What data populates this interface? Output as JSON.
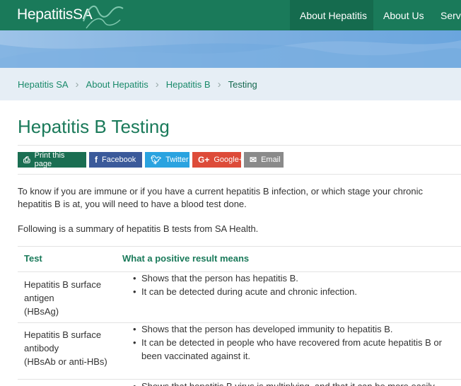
{
  "header": {
    "logo": "HepatitisSA",
    "nav": [
      "About Hepatitis",
      "About Us",
      "Servi"
    ]
  },
  "breadcrumb": [
    "Hepatitis SA",
    "About Hepatitis",
    "Hepatitis B",
    "Testing"
  ],
  "page_title": "Hepatitis B Testing",
  "share": {
    "print": "Print this page",
    "facebook": "Facebook",
    "twitter": "Twitter",
    "google": "Google+",
    "email": "Email"
  },
  "intro": [
    "To know if you are immune or if you have a current hepatitis B infection, or which stage your chronic hepatitis B is at, you will need to have a blood test done.",
    "Following is a summary of hepatitis B tests from SA Health."
  ],
  "table": {
    "headers": [
      "Test",
      "What a positive result means"
    ],
    "rows": [
      {
        "test": [
          "Hepatitis B surface antigen",
          "(HBsAg)"
        ],
        "results": [
          "Shows that the person has hepatitis B.",
          "It can be detected during acute and chronic infection."
        ]
      },
      {
        "test": [
          "Hepatitis B surface antibody",
          "(HBsAb or anti-HBs)"
        ],
        "results": [
          "Shows that the person has developed immunity to hepatitis B.",
          "It can be detected in people who have recovered from acute hepatitis B or been vaccinated against it."
        ]
      },
      {
        "test": [
          ""
        ],
        "results": [
          "Shows that hepatitis B virus is multiplying, and that it can be more easily"
        ]
      }
    ]
  },
  "colors": {
    "brand_green": "#1a7a5a",
    "breadcrumb_bg": "#e6eef5"
  }
}
